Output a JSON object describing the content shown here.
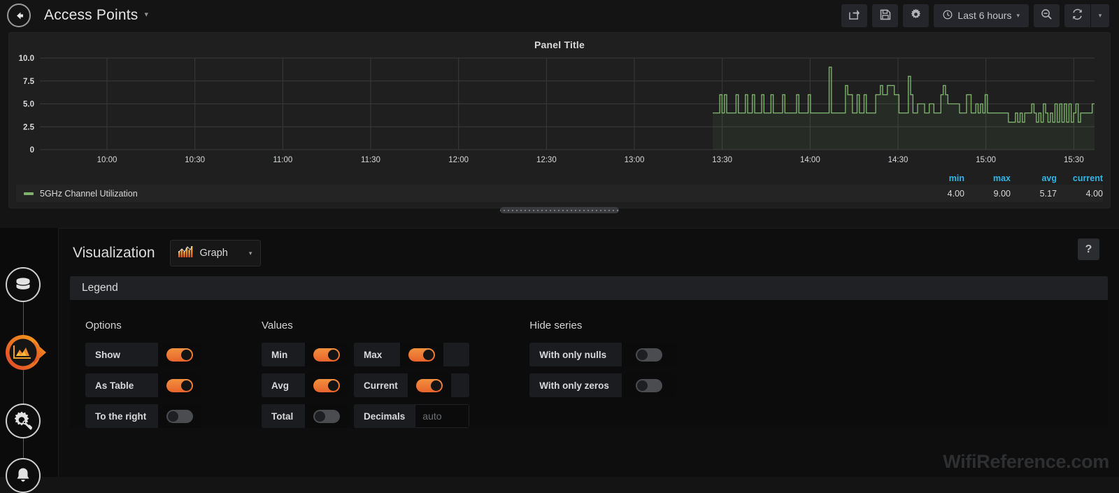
{
  "topnav": {
    "back_icon": "arrow-left-icon",
    "dashboard_title": "Access Points",
    "title_caret": "▾",
    "share_icon": "share-icon",
    "save_icon": "save-icon",
    "settings_icon": "gear-icon",
    "time_range": "Last 6 hours",
    "time_icon": "clock-icon",
    "time_caret": "▾",
    "zoom_out_icon": "zoom-out-icon",
    "refresh_icon": "refresh-icon",
    "refresh_caret": "▾"
  },
  "panel": {
    "title": "Panel Title",
    "legend_columns": [
      "min",
      "max",
      "avg",
      "current"
    ],
    "series_rows": [
      {
        "name": "5GHz Channel Utilization",
        "color": "#7eb26d",
        "min": "4.00",
        "max": "9.00",
        "avg": "5.17",
        "current": "4.00"
      }
    ],
    "resize_handle": "panel-resize-handle"
  },
  "chart_data": {
    "type": "line",
    "title": "Panel Title",
    "xlabel": "",
    "ylabel": "",
    "ylim": [
      0,
      10
    ],
    "yticks": [
      "0",
      "2.5",
      "5.0",
      "7.5",
      "10.0"
    ],
    "ytick_values": [
      0,
      2.5,
      5.0,
      7.5,
      10.0
    ],
    "xticks": [
      "10:00",
      "10:30",
      "11:00",
      "11:30",
      "12:00",
      "12:30",
      "13:00",
      "13:30",
      "14:00",
      "14:30",
      "15:00",
      "15:30"
    ],
    "grid": true,
    "legend_position": "bottom-table",
    "series": [
      {
        "name": "5GHz Channel Utilization",
        "color": "#7eb26d",
        "fill": true,
        "line_style": "stepped",
        "data_start_x": "13:19",
        "values": [
          4,
          4,
          4,
          6,
          4,
          6,
          4,
          4,
          4,
          4,
          6,
          4,
          4,
          4,
          6,
          4,
          4,
          6,
          4,
          4,
          4,
          6,
          4,
          4,
          4,
          6,
          4,
          4,
          4,
          4,
          6,
          4,
          4,
          4,
          4,
          4,
          6,
          4,
          4,
          4,
          4,
          6,
          4,
          4,
          4,
          4,
          4,
          4,
          4,
          4,
          9,
          4,
          4,
          4,
          4,
          4,
          4,
          7,
          6,
          6,
          4,
          4,
          6,
          4,
          4,
          6,
          4,
          4,
          4,
          4,
          6,
          6,
          7,
          6,
          6,
          7,
          7,
          7,
          6,
          6,
          4,
          4,
          4,
          4,
          8,
          6,
          4,
          4,
          5,
          5,
          5,
          4,
          4,
          5,
          5,
          4,
          4,
          4,
          6,
          7,
          6,
          5,
          5,
          5,
          5,
          5,
          4,
          4,
          4,
          6,
          6,
          4,
          4,
          5,
          4,
          5,
          4,
          6,
          4,
          4,
          4,
          4,
          4,
          4,
          4,
          4,
          4,
          3,
          3,
          3,
          4,
          3,
          4,
          3,
          4,
          4,
          4,
          5,
          4,
          3,
          4,
          3,
          5,
          4,
          3,
          4,
          3,
          5,
          3,
          5,
          3,
          5,
          3,
          5,
          3,
          4,
          5,
          3,
          4,
          4,
          4,
          4,
          4,
          5
        ]
      }
    ]
  },
  "editor": {
    "viz_label": "Visualization",
    "viz_selected": "Graph",
    "viz_icon": "graph-icon",
    "viz_caret": "▾",
    "help_label": "?",
    "section_title": "Legend",
    "groups": [
      {
        "title": "Options",
        "fields": [
          {
            "label": "Show",
            "control": "toggle",
            "state": "on"
          },
          {
            "label": "As Table",
            "control": "toggle",
            "state": "on"
          },
          {
            "label": "To the right",
            "control": "toggle",
            "state": "off"
          }
        ]
      },
      {
        "title": "Values",
        "fields_left": [
          {
            "label": "Min",
            "control": "toggle",
            "state": "on"
          },
          {
            "label": "Avg",
            "control": "toggle",
            "state": "on"
          },
          {
            "label": "Total",
            "control": "toggle",
            "state": "off"
          }
        ],
        "fields_right": [
          {
            "label": "Max",
            "control": "toggle",
            "state": "on"
          },
          {
            "label": "Current",
            "control": "toggle",
            "state": "on"
          },
          {
            "label": "Decimals",
            "control": "input",
            "value": "",
            "placeholder": "auto"
          }
        ]
      },
      {
        "title": "Hide series",
        "fields": [
          {
            "label": "With only nulls",
            "control": "toggle",
            "state": "off"
          },
          {
            "label": "With only zeros",
            "control": "toggle",
            "state": "off"
          }
        ]
      }
    ]
  },
  "sidebar": {
    "items": [
      {
        "name": "queries",
        "icon": "database-icon",
        "active": false
      },
      {
        "name": "visualization",
        "icon": "graph-area-icon",
        "active": true
      },
      {
        "name": "general",
        "icon": "gear-wrench-icon",
        "active": false
      },
      {
        "name": "alert",
        "icon": "bell-icon",
        "active": false
      }
    ]
  },
  "watermark": {
    "text": "WifiReference.com"
  },
  "colors": {
    "accent_orange": "#e8642c",
    "series_green": "#7eb26d",
    "legend_header_blue": "#33b5e5",
    "page_bg": "#141414"
  }
}
